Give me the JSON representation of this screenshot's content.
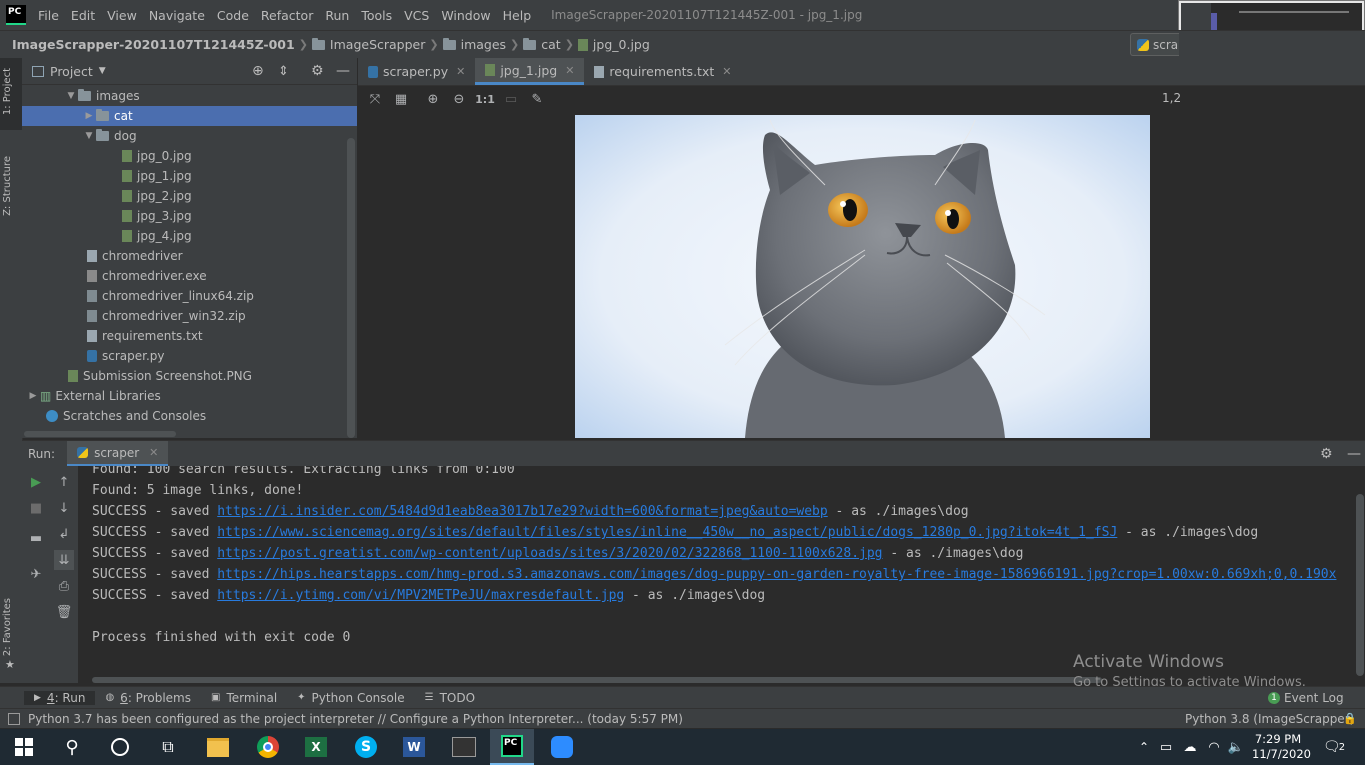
{
  "menubar": {
    "logo": "PC",
    "items": [
      "File",
      "Edit",
      "View",
      "Navigate",
      "Code",
      "Refactor",
      "Run",
      "Tools",
      "VCS",
      "Window",
      "Help"
    ],
    "window_title": "ImageScrapper-20201107T121445Z-001 - jpg_1.jpg"
  },
  "breadcrumbs": [
    "ImageScrapper-20201107T121445Z-001",
    "ImageScrapper",
    "images",
    "cat",
    "jpg_0.jpg"
  ],
  "run_config_label": "scra",
  "left_strip": {
    "project_tab": "1: Project",
    "structure_tab": "Z: Structure",
    "favorites_tab": "2: Favorites"
  },
  "project": {
    "title": "Project",
    "tree": [
      {
        "label": "images",
        "type": "folder",
        "expanded": true
      },
      {
        "label": "cat",
        "type": "folder",
        "expanded": false
      },
      {
        "label": "dog",
        "type": "folder",
        "expanded": true
      },
      {
        "label": "jpg_0.jpg",
        "type": "img"
      },
      {
        "label": "jpg_1.jpg",
        "type": "img"
      },
      {
        "label": "jpg_2.jpg",
        "type": "img"
      },
      {
        "label": "jpg_3.jpg",
        "type": "img"
      },
      {
        "label": "jpg_4.jpg",
        "type": "img"
      },
      {
        "label": "chromedriver",
        "type": "file"
      },
      {
        "label": "chromedriver.exe",
        "type": "exe"
      },
      {
        "label": "chromedriver_linux64.zip",
        "type": "zip"
      },
      {
        "label": "chromedriver_win32.zip",
        "type": "zip"
      },
      {
        "label": "requirements.txt",
        "type": "txt"
      },
      {
        "label": "scraper.py",
        "type": "py"
      },
      {
        "label": "Submission Screenshot.PNG",
        "type": "png"
      },
      {
        "label": "External Libraries",
        "type": "lib"
      },
      {
        "label": "Scratches and Consoles",
        "type": "scratch"
      }
    ]
  },
  "editor": {
    "tabs": [
      {
        "label": "scraper.py",
        "active": false
      },
      {
        "label": "jpg_1.jpg",
        "active": true
      },
      {
        "label": "requirements.txt",
        "active": false
      }
    ],
    "zoom_label": "1:1",
    "corner_text": "1,2"
  },
  "run": {
    "title": "Run:",
    "config": "scraper",
    "lines": [
      {
        "pre": "Found: 100 search results. Extracting links from 0:100",
        "link": "",
        "post": ""
      },
      {
        "pre": "Found: 5 image links, done!",
        "link": "",
        "post": ""
      },
      {
        "pre": "SUCCESS - saved ",
        "link": "https://i.insider.com/5484d9d1eab8ea3017b17e29?width=600&format=jpeg&auto=webp",
        "post": " - as ./images\\dog"
      },
      {
        "pre": "SUCCESS - saved ",
        "link": "https://www.sciencemag.org/sites/default/files/styles/inline__450w__no_aspect/public/dogs_1280p_0.jpg?itok=4t_1_fSJ",
        "post": " - as ./images\\dog"
      },
      {
        "pre": "SUCCESS - saved ",
        "link": "https://post.greatist.com/wp-content/uploads/sites/3/2020/02/322868_1100-1100x628.jpg",
        "post": " - as ./images\\dog"
      },
      {
        "pre": "SUCCESS - saved ",
        "link": "https://hips.hearstapps.com/hmg-prod.s3.amazonaws.com/images/dog-puppy-on-garden-royalty-free-image-1586966191.jpg?crop=1.00xw:0.669xh;0,0.190x",
        "post": ""
      },
      {
        "pre": "SUCCESS - saved ",
        "link": "https://i.ytimg.com/vi/MPV2METPeJU/maxresdefault.jpg",
        "post": " - as ./images\\dog"
      },
      {
        "pre": "",
        "link": "",
        "post": ""
      },
      {
        "pre": "Process finished with exit code 0",
        "link": "",
        "post": ""
      }
    ]
  },
  "watermark": {
    "line1": "Activate Windows",
    "line2": "Go to Settings to activate Windows."
  },
  "tooltabs": [
    {
      "num": "4",
      "label": ": Run"
    },
    {
      "num": "6",
      "label": ": Problems"
    },
    {
      "num": "",
      "label": "Terminal"
    },
    {
      "num": "",
      "label": "Python Console"
    },
    {
      "num": "",
      "label": "TODO"
    }
  ],
  "event_log": {
    "count": "1",
    "label": "Event Log"
  },
  "status": {
    "message": "Python 3.7 has been configured as the project interpreter // Configure a Python Interpreter... (today 5:57 PM)",
    "interpreter": "Python 3.8 (ImageScrapper)"
  },
  "taskbar": {
    "time": "7:29 PM",
    "date": "11/7/2020",
    "notifications": "2"
  },
  "colors": {
    "accent": "#4a88c7",
    "selection": "#4b6eaf",
    "link": "#287bde",
    "run_green": "#499c54"
  }
}
